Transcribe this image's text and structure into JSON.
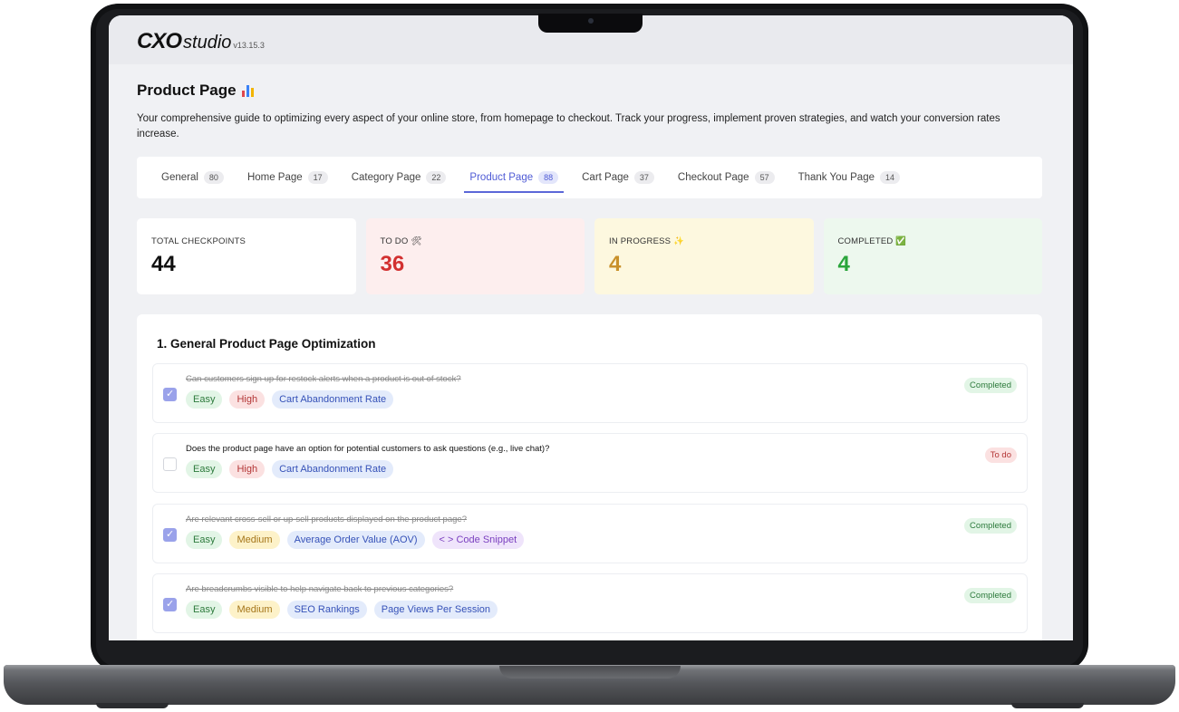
{
  "app": {
    "logo_mark": "CXO",
    "logo_word": "studio",
    "version": "v13.15.3"
  },
  "page": {
    "title": "Product Page",
    "title_icon": "bar-chart-icon",
    "description": "Your comprehensive guide to optimizing every aspect of your online store, from homepage to checkout. Track your progress, implement proven strategies, and watch your conversion rates increase."
  },
  "tabs": [
    {
      "label": "General",
      "count": "80"
    },
    {
      "label": "Home Page",
      "count": "17"
    },
    {
      "label": "Category Page",
      "count": "22"
    },
    {
      "label": "Product Page",
      "count": "88"
    },
    {
      "label": "Cart Page",
      "count": "37"
    },
    {
      "label": "Checkout Page",
      "count": "57"
    },
    {
      "label": "Thank You Page",
      "count": "14"
    }
  ],
  "active_tab": "Product Page",
  "stats": {
    "total": {
      "label": "TOTAL CHECKPOINTS",
      "value": "44"
    },
    "todo": {
      "label": "TO DO 🛠",
      "value": "36"
    },
    "in_progress": {
      "label": "IN PROGRESS ✨",
      "value": "4"
    },
    "completed": {
      "label": "COMPLETED ✅",
      "value": "4"
    }
  },
  "section": {
    "title": "1. General Product Page Optimization",
    "items": [
      {
        "question": "Can customers sign up for restock alerts when a product is out of stock?",
        "checked": true,
        "tags": [
          "Easy",
          "High",
          "Cart Abandonment Rate"
        ],
        "status": "Completed"
      },
      {
        "question": "Does the product page have an option for potential customers to ask questions (e.g., live chat)?",
        "checked": false,
        "tags": [
          "Easy",
          "High",
          "Cart Abandonment Rate"
        ],
        "status": "To do"
      },
      {
        "question": "Are relevant cross-sell or up-sell products displayed on the product page?",
        "checked": true,
        "tags": [
          "Easy",
          "Medium",
          "Average Order Value (AOV)",
          "< > Code Snippet"
        ],
        "status": "Completed"
      },
      {
        "question": "Are breadcrumbs visible to help navigate back to previous categories?",
        "checked": true,
        "tags": [
          "Easy",
          "Medium",
          "SEO Rankings",
          "Page Views Per Session"
        ],
        "status": "Completed"
      }
    ]
  },
  "colors": {
    "accent": "#5b67d8",
    "todo": "#d23030",
    "in_progress": "#c9912b",
    "completed": "#2aa53b"
  }
}
